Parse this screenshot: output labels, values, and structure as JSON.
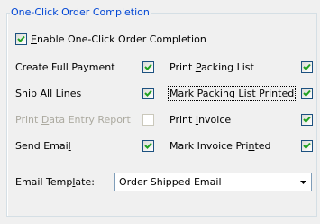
{
  "group": {
    "title": "One-Click Order Completion"
  },
  "enable": {
    "label_pre": "",
    "label_key": "E",
    "label_post": "nable One-Click Order Completion",
    "checked": true
  },
  "options": {
    "create_full_payment": {
      "label": "Create Full Payment",
      "checked": true,
      "enabled": true
    },
    "print_packing_list": {
      "label_pre": "Print ",
      "label_key": "P",
      "label_post": "acking List",
      "checked": true,
      "enabled": true
    },
    "ship_all_lines": {
      "label_pre": "",
      "label_key": "S",
      "label_post": "hip All Lines",
      "checked": true,
      "enabled": true
    },
    "mark_packing_list_printed": {
      "label_pre": "",
      "label_key": "M",
      "label_post": "ark Packing List Printed",
      "checked": true,
      "enabled": true
    },
    "print_data_entry_report": {
      "label_pre": "Print ",
      "label_key": "D",
      "label_post": "ata Entry Report",
      "checked": false,
      "enabled": false
    },
    "print_invoice": {
      "label_pre": "Print ",
      "label_key": "I",
      "label_post": "nvoice",
      "checked": true,
      "enabled": true
    },
    "send_email": {
      "label_pre": "Send Emai",
      "label_key": "l",
      "label_post": "",
      "checked": true,
      "enabled": true
    },
    "mark_invoice_printed": {
      "label_pre": "Mark Invoice Pri",
      "label_key": "n",
      "label_post": "ted",
      "checked": true,
      "enabled": true
    }
  },
  "email_template": {
    "label_pre": "Email Temp",
    "label_key": "l",
    "label_post": "ate:",
    "value": "Order Shipped Email"
  },
  "colors": {
    "legend": "#0046d5",
    "check": "#21a121",
    "checkbox_border": "#1c5180",
    "disabled_text": "#acaaa0"
  },
  "icons": {
    "checkmark": "checkmark-icon",
    "dropdown": "dropdown-arrow-icon"
  }
}
